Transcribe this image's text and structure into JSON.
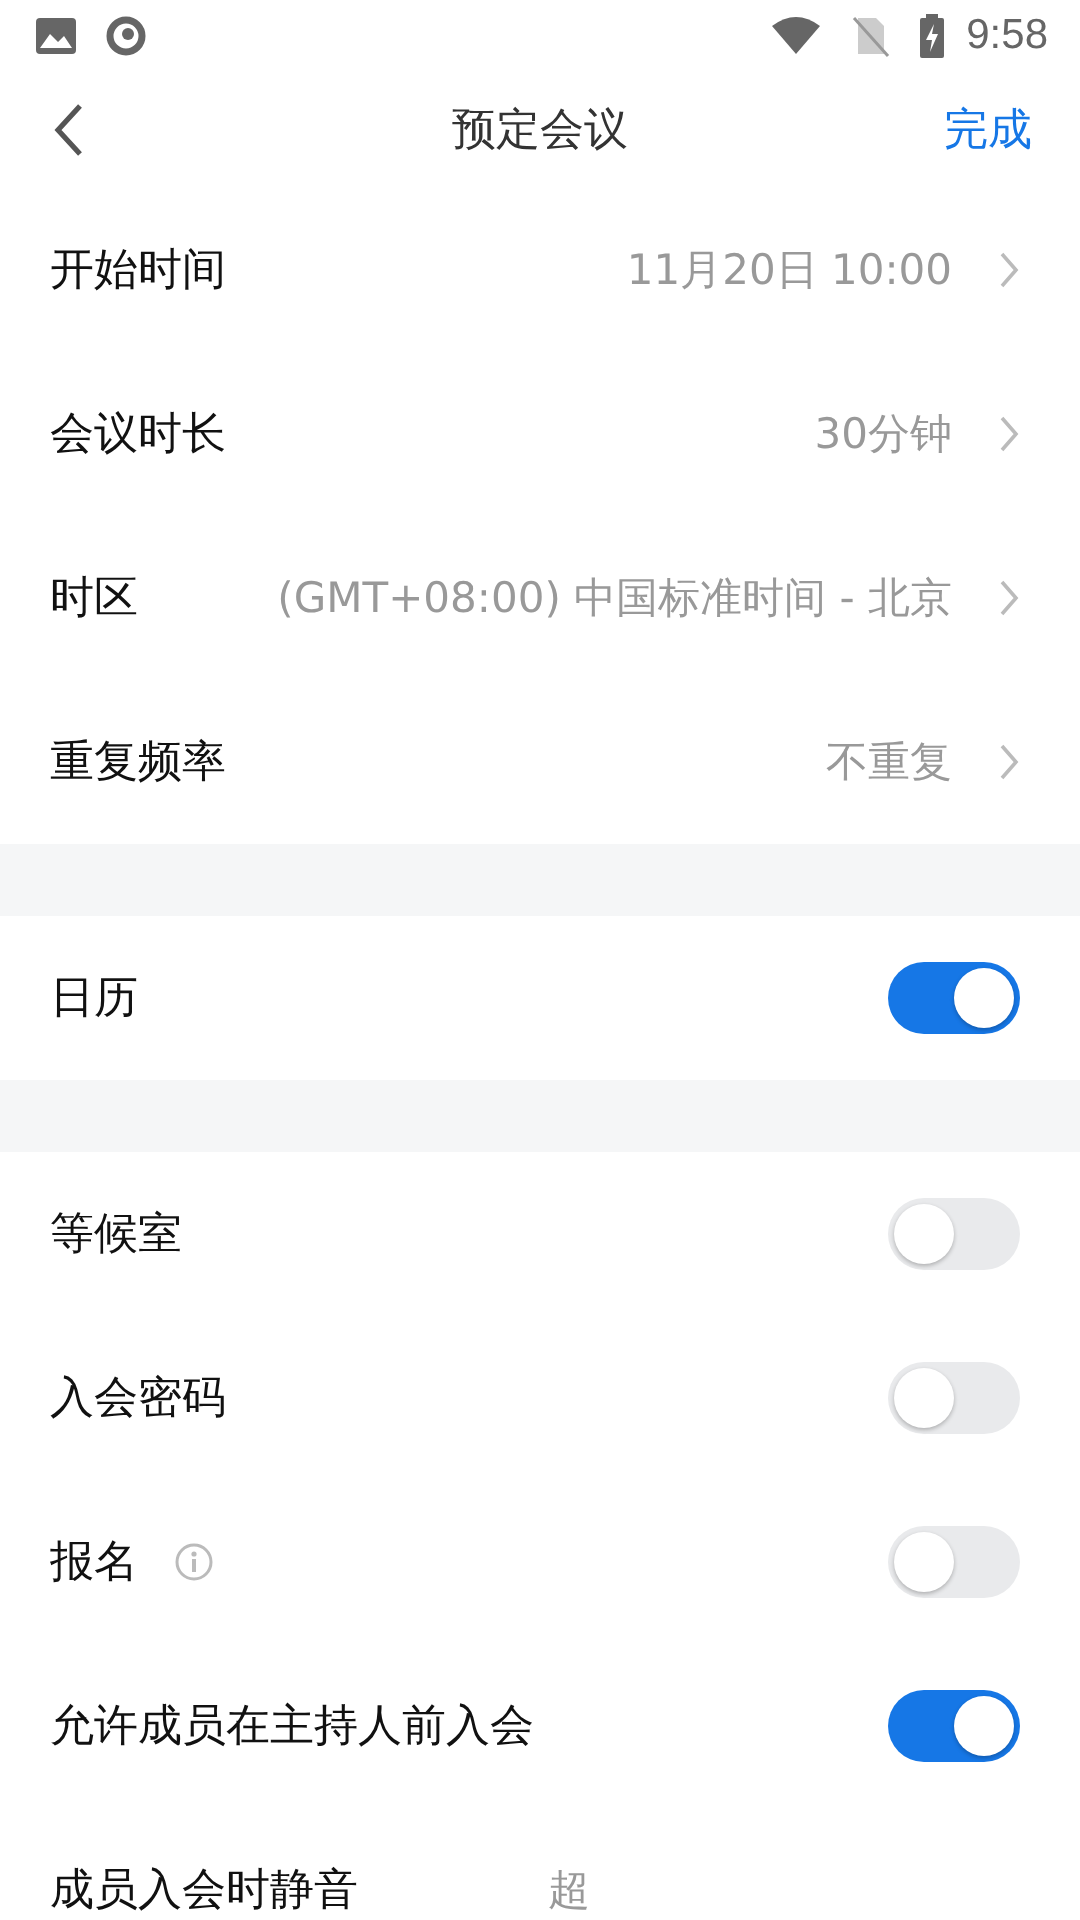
{
  "status_bar": {
    "time": "9:58"
  },
  "header": {
    "title": "预定会议",
    "action": "完成"
  },
  "sections": [
    {
      "items": [
        {
          "kind": "link",
          "label": "开始时间",
          "value": "11月20日 10:00"
        },
        {
          "kind": "link",
          "label": "会议时长",
          "value": "30分钟"
        },
        {
          "kind": "link",
          "label": "时区",
          "value": "(GMT+08:00) 中国标准时间 - 北京"
        },
        {
          "kind": "link",
          "label": "重复频率",
          "value": "不重复"
        }
      ]
    },
    {
      "items": [
        {
          "kind": "toggle",
          "label": "日历",
          "on": true
        }
      ]
    },
    {
      "items": [
        {
          "kind": "toggle",
          "label": "等候室",
          "on": false
        },
        {
          "kind": "toggle",
          "label": "入会密码",
          "on": false
        },
        {
          "kind": "toggle",
          "label": "报名",
          "info": true,
          "on": false
        },
        {
          "kind": "toggle",
          "label": "允许成员在主持人前入会",
          "on": true
        },
        {
          "kind": "text",
          "label": "成员入会时静音",
          "value": "超"
        }
      ]
    }
  ]
}
